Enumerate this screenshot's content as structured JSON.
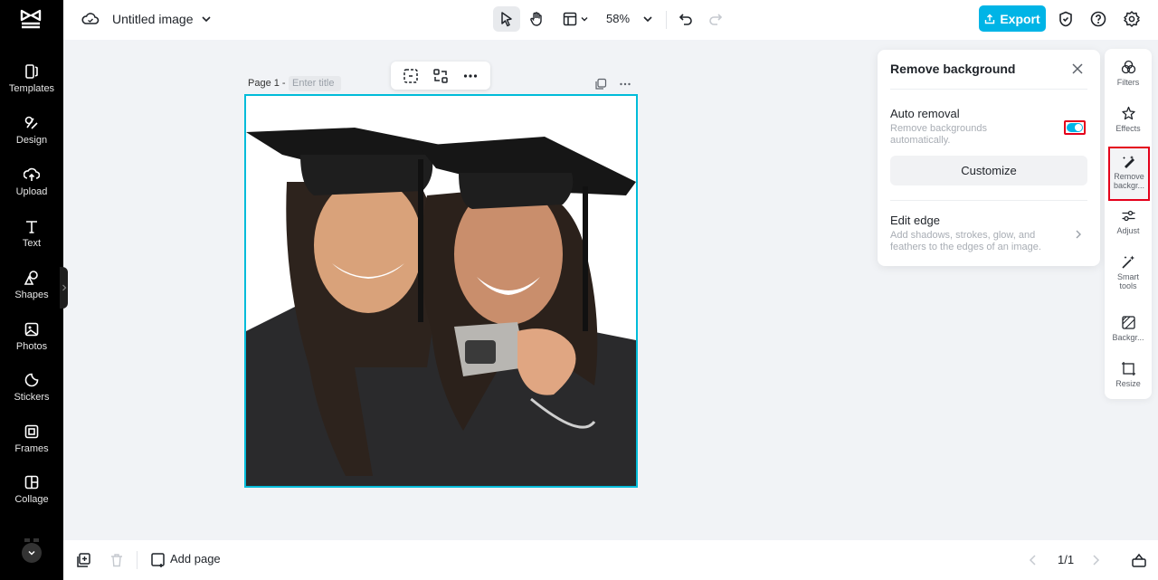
{
  "sidebar": {
    "items": [
      {
        "label": "Templates",
        "icon": "templates-icon"
      },
      {
        "label": "Design",
        "icon": "design-icon"
      },
      {
        "label": "Upload",
        "icon": "upload-icon"
      },
      {
        "label": "Text",
        "icon": "text-icon"
      },
      {
        "label": "Shapes",
        "icon": "shapes-icon"
      },
      {
        "label": "Photos",
        "icon": "photos-icon"
      },
      {
        "label": "Stickers",
        "icon": "stickers-icon"
      },
      {
        "label": "Frames",
        "icon": "frames-icon"
      },
      {
        "label": "Collage",
        "icon": "collage-icon"
      }
    ]
  },
  "header": {
    "title": "Untitled image",
    "zoom": "58%",
    "export_label": "Export"
  },
  "canvas": {
    "page_label": "Page 1 -",
    "title_placeholder": "Enter title"
  },
  "remove_bg_panel": {
    "title": "Remove background",
    "auto_removal_label": "Auto removal",
    "auto_removal_desc_1": "Remove backgrounds",
    "auto_removal_desc_2": "automatically.",
    "auto_removal_on": true,
    "customize_label": "Customize",
    "edit_edge_label": "Edit edge",
    "edit_edge_desc_1": "Add shadows, strokes, glow, and",
    "edit_edge_desc_2": "feathers to the edges of an image."
  },
  "rail": {
    "items": [
      {
        "label": "Filters"
      },
      {
        "label": "Effects"
      },
      {
        "label_1": "Remove",
        "label_2": "backgr..."
      },
      {
        "label": "Adjust"
      },
      {
        "label_1": "Smart",
        "label_2": "tools"
      },
      {
        "label": "Backgr..."
      },
      {
        "label": "Resize"
      }
    ]
  },
  "footer": {
    "add_page_label": "Add page",
    "pager": "1/1"
  },
  "colors": {
    "accent": "#00b4e6",
    "highlight": "#e4001b",
    "selection": "#00bcd9"
  }
}
